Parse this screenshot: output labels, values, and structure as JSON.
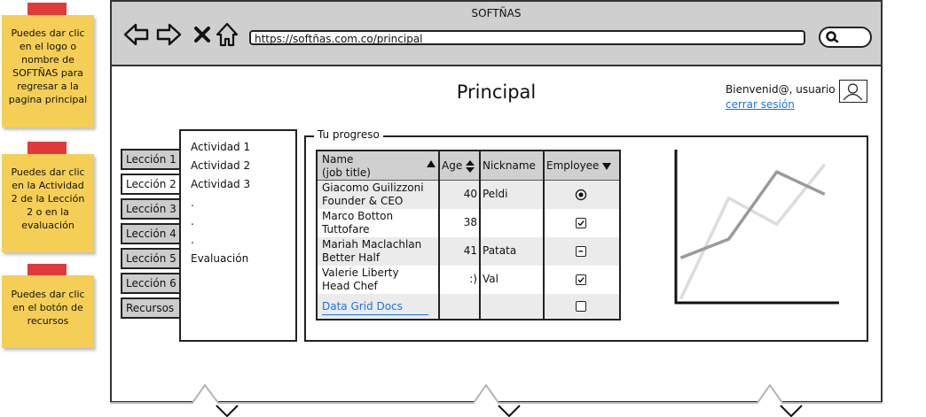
{
  "notes": [
    {
      "text": "Puedes dar clic en el logo o nombre de SOFTÑAS para regresar a la pagina principal"
    },
    {
      "text": "Puedes dar clic en la Actividad 2 de la Lección 2 o en la evaluación"
    },
    {
      "text": "Puedes dar clic en el botón de recursos"
    }
  ],
  "browser": {
    "title": "SOFTÑAS",
    "url": "https://softñas.com.co/principal"
  },
  "header": {
    "page_title": "Principal",
    "welcome": "Bienvenid@, usuario",
    "logout": "cerrar sesión"
  },
  "tabs": [
    "Lección 1",
    "Lección 2",
    "Lección 3",
    "Lección 4",
    "Lección 5",
    "Lección 6",
    "Recursos"
  ],
  "active_tab": "Lección 2",
  "activities": [
    "Actividad 1",
    "Actividad 2",
    "Actividad 3",
    ".",
    ".",
    ".",
    "Evaluación"
  ],
  "progress": {
    "legend": "Tu progreso",
    "columns": {
      "name": "Name",
      "name_sub": "(job title)",
      "age": "Age",
      "nickname": "Nickname",
      "employee": "Employee"
    },
    "rows": [
      {
        "name": "Giacomo Guilizzoni",
        "title": "Founder & CEO",
        "age": "40",
        "nickname": "Peldi",
        "employee": "radio"
      },
      {
        "name": "Marco Botton",
        "title": "Tuttofare",
        "age": "38",
        "nickname": "",
        "employee": "checked"
      },
      {
        "name": "Mariah Maclachlan",
        "title": "Better Half",
        "age": "41",
        "nickname": "Patata",
        "employee": "indeterminate"
      },
      {
        "name": "Valerie Liberty",
        "title": "Head Chef",
        "age": ":)",
        "nickname": "Val",
        "employee": "checked"
      }
    ],
    "footer_link": "Data Grid Docs",
    "footer_employee": "unchecked"
  },
  "chart_data": {
    "type": "line",
    "x": [
      0,
      1,
      2,
      3
    ],
    "series": [
      {
        "values": [
          1.2,
          1.7,
          3.5,
          2.9
        ],
        "color": "#9a9a9a"
      },
      {
        "values": [
          0.1,
          2.8,
          2.1,
          3.7
        ],
        "color": "#dcdcdc"
      }
    ],
    "ylim": [
      0,
      4
    ],
    "xlim": [
      -0.1,
      3.3
    ]
  },
  "colors": {
    "note": "#f5cf55",
    "tape": "#e23a3a",
    "link": "#1a73e8",
    "titlebar": "#cfcfcf"
  }
}
